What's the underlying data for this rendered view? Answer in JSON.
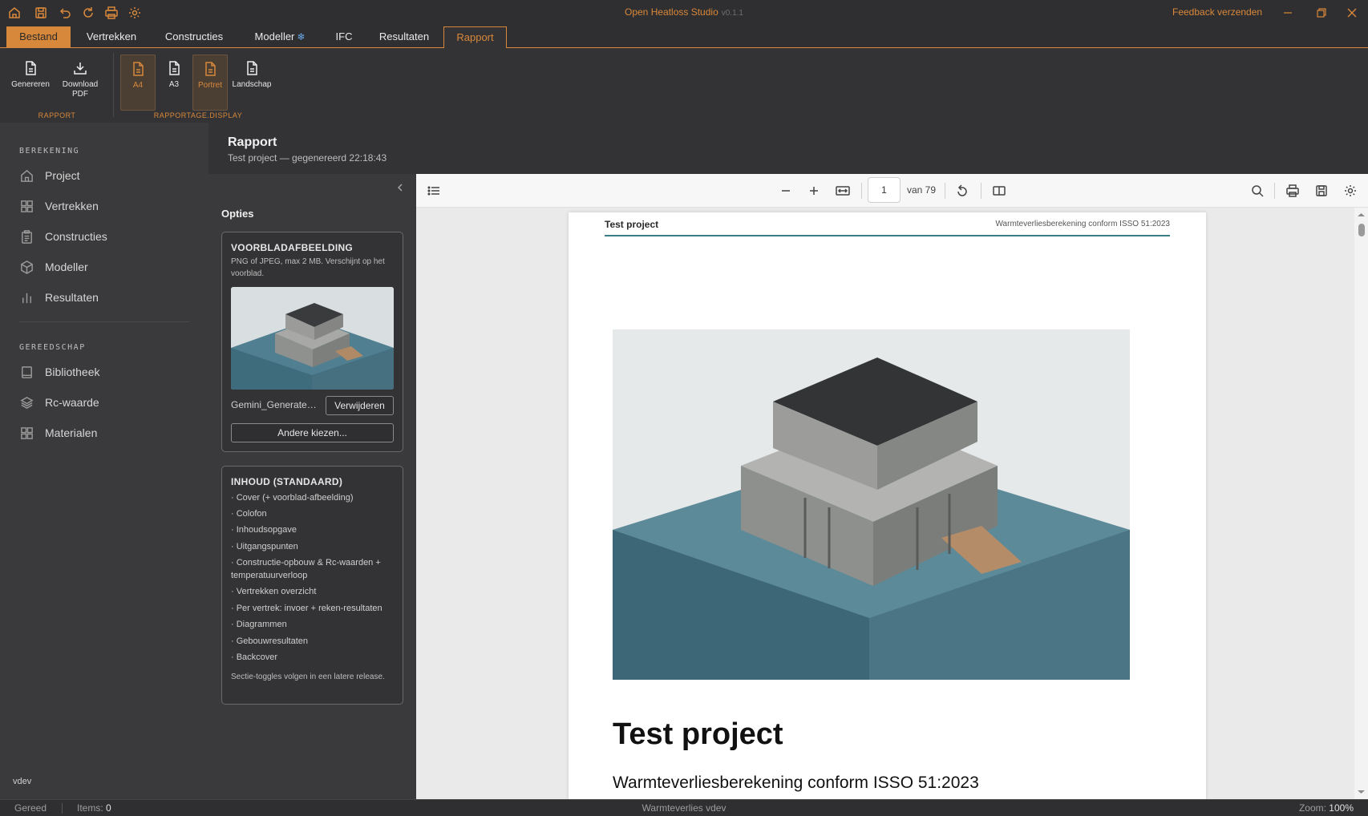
{
  "titlebar": {
    "app_title": "Open Heatloss Studio",
    "version": "v0.1.1",
    "feedback": "Feedback verzenden",
    "icons": [
      "home-icon",
      "save-icon",
      "undo-icon",
      "redo-icon",
      "print-icon",
      "settings-icon"
    ],
    "accent_color": "#d8883a"
  },
  "tabs": [
    "Bestand",
    "Vertrekken",
    "Constructies",
    "Modeller",
    "IFC",
    "Resultaten",
    "Rapport"
  ],
  "ribbon": {
    "generate": "Genereren",
    "download_pdf_1": "Download",
    "download_pdf_2": "PDF",
    "a4": "A4",
    "a3": "A3",
    "portrait": "Portret",
    "landscape": "Landschap",
    "group_report": "RAPPORT",
    "group_display": "RAPPORTAGE.DISPLAY"
  },
  "sidebar": {
    "section_calc": "BEREKENING",
    "calc_items": [
      "Project",
      "Vertrekken",
      "Constructies",
      "Modeller",
      "Resultaten"
    ],
    "section_tools": "GEREEDSCHAP",
    "tool_items": [
      "Bibliotheek",
      "Rc-waarde",
      "Materialen"
    ],
    "user": "vdev"
  },
  "page": {
    "title": "Rapport",
    "subtitle": "Test project — gegenereerd 22:18:43"
  },
  "options": {
    "title": "Opties",
    "cover_card": {
      "title": "VOORBLADAFBEELDING",
      "note": "PNG of JPEG, max 2 MB. Verschijnt op het voorblad.",
      "file_name": "Gemini_Generated_Image.png",
      "remove": "Verwijderen",
      "choose": "Andere kiezen..."
    },
    "content_card": {
      "title": "INHOUD (STANDAARD)",
      "items": [
        "· Cover (+ voorblad-afbeelding)",
        "· Colofon",
        "· Inhoudsopgave",
        "· Uitgangspunten",
        "· Constructie-opbouw & Rc-waarden + temperatuurverloop",
        "· Vertrekken overzicht",
        "· Per vertrek: invoer + reken-resultaten",
        "· Diagrammen",
        "· Gebouwresultaten",
        "· Backcover"
      ],
      "footnote": "Sectie-toggles volgen in een latere release."
    }
  },
  "viewer": {
    "page_number": "1",
    "page_of": "van 79",
    "header_left": "Test project",
    "header_right": "Warmteverliesberekening conform ISSO 51:2023",
    "cover_title": "Test project",
    "cover_subtitle": "Warmteverliesberekening conform ISSO 51:2023"
  },
  "statusbar": {
    "ready": "Gereed",
    "items_label": "Items:",
    "items_value": "0",
    "center": "Warmteverlies vdev",
    "zoom_label": "Zoom:",
    "zoom_value": "100%"
  }
}
